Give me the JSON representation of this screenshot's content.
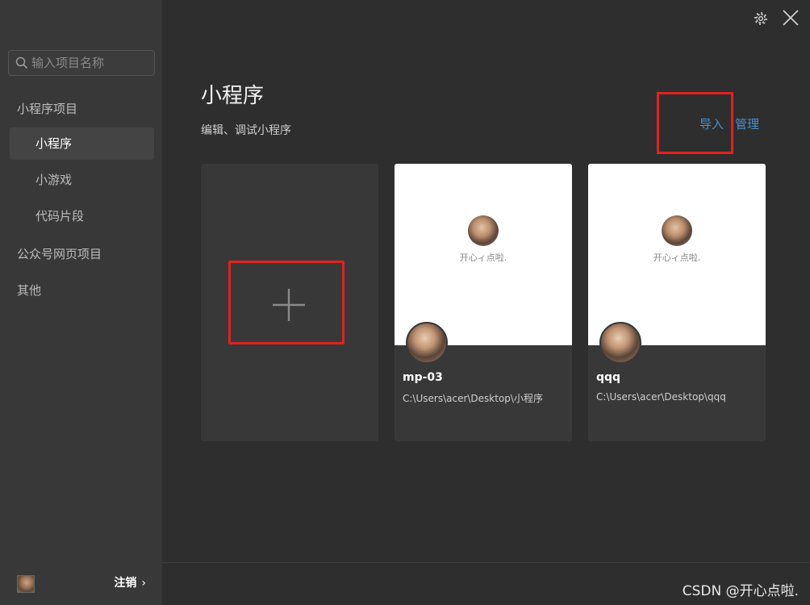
{
  "sidebar": {
    "search_placeholder": "输入项目名称",
    "group_miniprogram": "小程序项目",
    "items": [
      {
        "label": "小程序"
      },
      {
        "label": "小游戏"
      },
      {
        "label": "代码片段"
      }
    ],
    "group_official": "公众号网页项目",
    "group_other": "其他",
    "logout_label": "注销",
    "logout_chevron": "›"
  },
  "header": {
    "title": "小程序",
    "subtitle": "编辑、调试小程序",
    "import_label": "导入",
    "manage_label": "管理"
  },
  "projects": [
    {
      "name": "mp-03",
      "path": "C:\\Users\\acer\\Desktop\\小程序",
      "preview_text": "开心ィ点啦."
    },
    {
      "name": "qqq",
      "path": "C:\\Users\\acer\\Desktop\\qqq",
      "preview_text": "开心ィ点啦."
    }
  ],
  "colors": {
    "accent": "#4a90c9",
    "highlight": "#e0221f",
    "background": "#2e2e2e",
    "sidebar": "#383838"
  },
  "watermark": "CSDN @开心点啦."
}
